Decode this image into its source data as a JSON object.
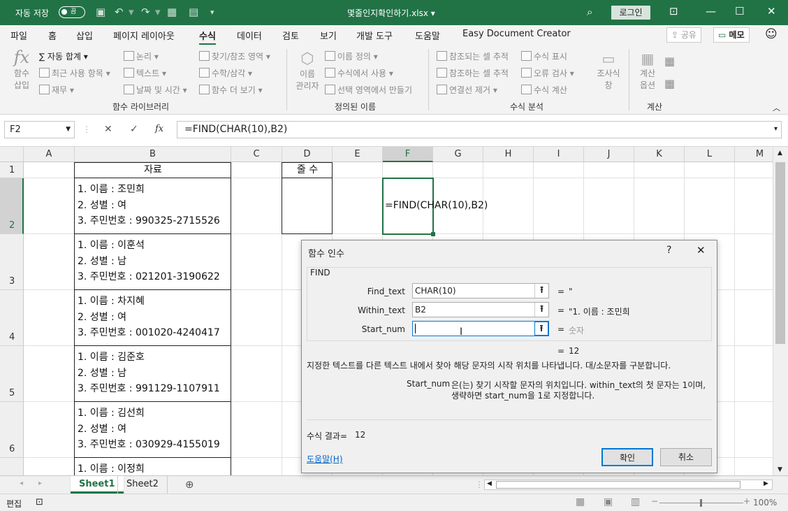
{
  "titlebar": {
    "autosave": "자동 저장",
    "toggle": "끔",
    "filename": "몇줄인지확인하기.xlsx",
    "dropdown": "▾",
    "login": "로그인"
  },
  "menu": {
    "items": [
      "파일",
      "홈",
      "삽입",
      "페이지 레이아웃",
      "수식",
      "데이터",
      "검토",
      "보기",
      "개발 도구",
      "도움말",
      "Easy Document Creator"
    ],
    "share": "공유",
    "memo": "메모"
  },
  "ribbon": {
    "func_insert": [
      "함수",
      "삽입"
    ],
    "autosum": "자동 합계",
    "recent": "최근 사용 항목",
    "finance": "재무",
    "logic": "논리",
    "text": "텍스트",
    "datetime": "날짜 및 시간",
    "lookup": "찾기/참조 영역",
    "math": "수학/삼각",
    "more": "함수 더 보기",
    "group1": "함수 라이브러리",
    "name_mgr": [
      "이름",
      "관리자"
    ],
    "define_name": "이름 정의",
    "use_in_formula": "수식에서 사용",
    "create_from_sel": "선택 영역에서 만들기",
    "group2": "정의된 이름",
    "trace_prec": "참조되는 셀 추적",
    "trace_dep": "참조하는 셀 추적",
    "remove_arrows": "연결선 제거",
    "show_formulas": "수식 표시",
    "error_check": "오류 검사",
    "eval_formula": "수식 계산",
    "watch": [
      "조사식",
      "창"
    ],
    "group3": "수식 분석",
    "calc_opts": [
      "계산",
      "옵션"
    ],
    "group4": "계산"
  },
  "formulabar": {
    "namebox": "F2",
    "formula": "=FIND(CHAR(10),B2)",
    "cancel": "✕",
    "enter": "✓",
    "fx": "fx"
  },
  "columns": [
    "A",
    "B",
    "C",
    "D",
    "E",
    "F",
    "G",
    "H",
    "I",
    "J",
    "K",
    "L",
    "M"
  ],
  "rows": [
    "1",
    "2",
    "3",
    "4",
    "5",
    "6"
  ],
  "cells": {
    "B1": "자료",
    "D1": "줄 수",
    "F2": "=FIND(CHAR(10),B2)",
    "records": [
      [
        "1. 이름 : 조민희",
        "2. 성별 : 여",
        "3. 주민번호 : 990325-2715526"
      ],
      [
        "1. 이름 : 이훈석",
        "2. 성별 : 남",
        "3. 주민번호 : 021201-3190622"
      ],
      [
        "1. 이름 : 차지혜",
        "2. 성별 : 여",
        "3. 주민번호 : 001020-4240417"
      ],
      [
        "1. 이름 : 김준호",
        "2. 성별 : 남",
        "3. 주민번호 : 991129-1107911"
      ],
      [
        "1. 이름 : 김선희",
        "2. 성별 : 여",
        "3. 주민번호 : 030929-4155019"
      ],
      [
        "1. 이름 : 이정희"
      ]
    ]
  },
  "sheets": {
    "tabs": [
      "Sheet1",
      "Sheet2"
    ],
    "active": "Sheet1",
    "add": "⊕"
  },
  "status": {
    "mode": "편집",
    "zoom": "100%"
  },
  "dialog": {
    "title": "함수 인수",
    "help_q": "?",
    "close": "✕",
    "func": "FIND",
    "args": [
      {
        "label": "Find_text",
        "value": "CHAR(10)",
        "result": "\""
      },
      {
        "label": "Within_text",
        "value": "B2",
        "result": "\"1. 이름 : 조민희"
      },
      {
        "label": "Start_num",
        "value": "",
        "result": "숫자"
      }
    ],
    "equals": "=",
    "func_result": "12",
    "description": "지정한 텍스트를 다른 텍스트 내에서 찾아 해당 문자의 시작 위치를 나타냅니다. 대/소문자를 구분합니다.",
    "arg_help_name": "Start_num",
    "arg_help_line1": "은(는) 찾기 시작할 문자의 위치입니다. within_text의 첫 문자는 1이며,",
    "arg_help_line2": "생략하면 start_num을 1로 지정합니다.",
    "formula_result_label": "수식 결과=",
    "formula_result": "12",
    "help_link": "도움말(H)",
    "ok": "확인",
    "cancel": "취소"
  }
}
